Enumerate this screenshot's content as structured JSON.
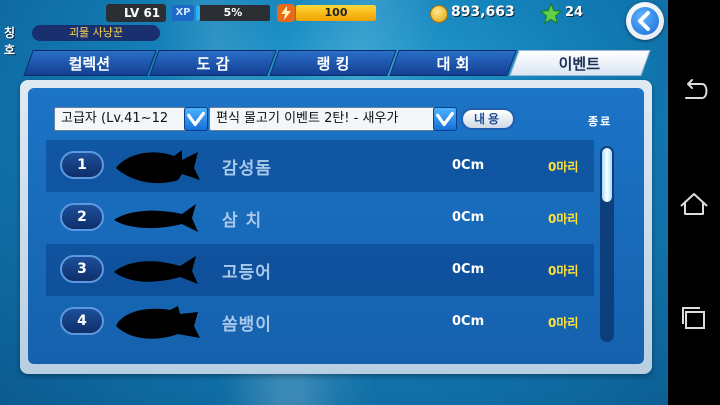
{
  "status_bar": {
    "level": "LV 61",
    "xp_label": "XP",
    "xp_percent": "5%",
    "xp_fraction": 0.05,
    "energy": "100",
    "energy_fraction": 1.0,
    "coins": "893,663",
    "stars": "24"
  },
  "title": {
    "label": "칭호",
    "value": "괴물 사냥꾼"
  },
  "tabs": [
    {
      "label": "컬렉션",
      "active": false
    },
    {
      "label": "도  감",
      "active": false
    },
    {
      "label": "랭  킹",
      "active": false
    },
    {
      "label": "대  회",
      "active": false
    },
    {
      "label": "이벤트",
      "active": true
    }
  ],
  "filters": {
    "grade": "고급자 (Lv.41~12",
    "event": "편식 물고기 이벤트 2탄! - 새우가",
    "info_button": "내용",
    "status": "종료"
  },
  "fish_list": [
    {
      "rank": "1",
      "name": "감성돔",
      "size": "0Cm",
      "count": "0마리"
    },
    {
      "rank": "2",
      "name": "삼 치",
      "size": "0Cm",
      "count": "0마리"
    },
    {
      "rank": "3",
      "name": "고등어",
      "size": "0Cm",
      "count": "0마리"
    },
    {
      "rank": "4",
      "name": "쏨뱅이",
      "size": "0Cm",
      "count": "0마리"
    }
  ],
  "icons": {
    "energy": "lightning-icon",
    "coin": "coin-icon",
    "star": "star-icon",
    "back": "back-arrow-icon",
    "android_back": "android-back-icon",
    "android_home": "android-home-icon",
    "android_recents": "android-recents-icon"
  },
  "colors": {
    "accent": "#1769d4",
    "count_yellow": "#ffe23a",
    "panel_blue": "#1c74c7"
  }
}
